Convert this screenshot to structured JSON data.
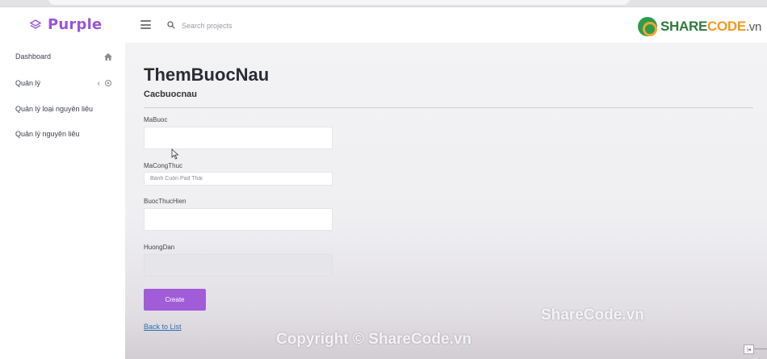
{
  "brand": {
    "name": "Purple"
  },
  "search": {
    "placeholder": "Search projects"
  },
  "watermark": {
    "logo_share": "SHARE",
    "logo_code": "CODE",
    "logo_vn": ".vn",
    "mid": "ShareCode.vn",
    "bottom": "Copyright © ShareCode.vn"
  },
  "sidebar": {
    "items": [
      {
        "label": "Dashboard"
      },
      {
        "label": "Quản lý"
      },
      {
        "label": "Quản lý loại nguyên liêu"
      },
      {
        "label": "Quản lý nguyên liêu"
      }
    ]
  },
  "page": {
    "title": "ThemBuocNau",
    "subtitle": "Cacbuocnau"
  },
  "form": {
    "fields": [
      {
        "label": "MaBuoc",
        "value": ""
      },
      {
        "label": "MaCongThuc",
        "value": "Bánh Cuốn Pad Thái"
      },
      {
        "label": "BuocThucHien",
        "value": ""
      },
      {
        "label": "HuongDan",
        "value": ""
      }
    ],
    "submit_label": "Create",
    "back_label": "Back to List"
  },
  "colors": {
    "accent": "#a15cd8",
    "brand": "#9a55d8",
    "link": "#2d6eb5"
  }
}
